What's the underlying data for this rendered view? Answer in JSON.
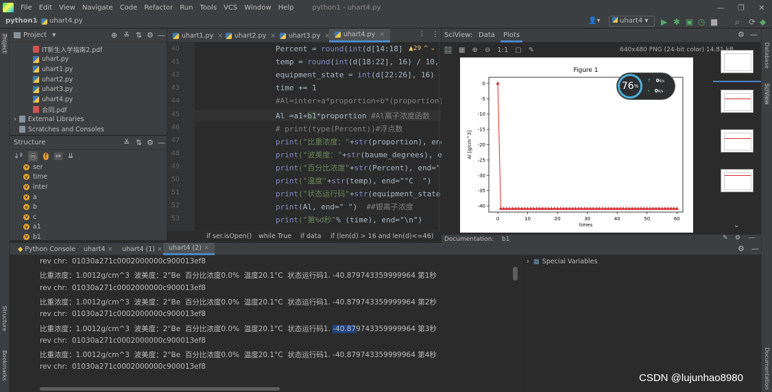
{
  "app": {
    "name": "python1",
    "title": "python1 - uhart4.py",
    "file": "uhart4.py"
  },
  "menu": [
    "File",
    "Edit",
    "View",
    "Navigate",
    "Code",
    "Refactor",
    "Run",
    "Tools",
    "VCS",
    "Window",
    "Help"
  ],
  "run_config": "uhart4",
  "project": {
    "label": "Project",
    "files": [
      "IT新生入学指南2.pdf",
      "uhart.py",
      "uhart1.py",
      "uhart2.py",
      "uhart3.py",
      "uhart4.py",
      "合同.pdf"
    ],
    "external": "External Libraries",
    "scratches": "Scratches and Consoles"
  },
  "structure": {
    "label": "Structure",
    "vars": [
      "ser",
      "time",
      "inter",
      "a",
      "b",
      "c",
      "a1",
      "b1"
    ]
  },
  "editor": {
    "tabs": [
      "uhart1.py",
      "uhart2.py",
      "uhart3.py",
      "uhart4.py"
    ],
    "line_numbers": [
      "40",
      "41",
      "42",
      "43",
      "44",
      "45",
      "46",
      "47",
      "48",
      "49",
      "50",
      "51",
      "52",
      "53"
    ],
    "warnings": "29",
    "lines": [
      [
        "Percent = ",
        "round",
        "(",
        "int",
        "(d[14:18]"
      ],
      [
        "temp = ",
        "round",
        "(",
        "int",
        "(d[18:22], 16) / 10, 1"
      ],
      [
        "equipment_state = ",
        "int",
        "(d[22:26], 16)"
      ],
      [
        "time += 1"
      ],
      [
        "#Al=inter+a*proportion+b*(proportion)"
      ],
      [
        "Al =a1+",
        "b1",
        "*proportion ",
        "#Al离子浓度函数"
      ],
      [
        "# print(type(Percent))#浮点数"
      ],
      [
        "print",
        "(\"比重浓度：\"",
        "+",
        "str",
        "(proportion), end"
      ],
      [
        "print",
        "(\"波美度：\"",
        "+",
        "str",
        "(baume_degrees), e"
      ],
      [
        "print",
        "(\"百分比浓度\"",
        "+",
        "str",
        "(Percent), end=\""
      ],
      [
        "print",
        "(\"温度\"",
        "+",
        "str",
        "(temp), end=\"°C  \")"
      ],
      [
        "print",
        "(\"状态运行码\"",
        "+",
        "str",
        "(equipment_state)"
      ],
      [
        "print",
        "(Al, end=\" \")  ",
        "##银离子浓度"
      ],
      [
        "print",
        "(\"第%d秒\"",
        "% ",
        "(time)",
        ", end=\"\\n\")"
      ]
    ],
    "breadcrumb": [
      "if ser.isOpen()",
      "while True",
      "if data",
      "if (len(d) > 16 and len(d)<=46)"
    ]
  },
  "sciview": {
    "label": "SciView:",
    "tabs": [
      "Data",
      "Plots"
    ],
    "info": "640x480 PNG (24-bit color) 14.81 kB",
    "doc": "Documentation:",
    "doc2": "b1"
  },
  "chart_data": {
    "type": "line",
    "title": "Figure 1",
    "xlabel": "times",
    "ylabel": "Al [g/cm^3]",
    "xlim": [
      -3,
      62
    ],
    "ylim": [
      -42,
      2
    ],
    "xticks": [
      0,
      10,
      20,
      30,
      40,
      50,
      60
    ],
    "yticks": [
      0,
      -5,
      -10,
      -15,
      -20,
      -25,
      -30,
      -35,
      -40
    ],
    "series": [
      {
        "color": "#d62728",
        "x": [
          0,
          1,
          2,
          3,
          4,
          5,
          6,
          7,
          8,
          9,
          10,
          11,
          12,
          13,
          14,
          15,
          16,
          17,
          18,
          19,
          20,
          21,
          22,
          23,
          24,
          25,
          26,
          27,
          28,
          29,
          30,
          31,
          32,
          33,
          34,
          35,
          36,
          37,
          38,
          39,
          40,
          41,
          42,
          43,
          44,
          45,
          46,
          47,
          48,
          49,
          50,
          51,
          52,
          53,
          54,
          55,
          56,
          57,
          58,
          59,
          60
        ],
        "y": [
          0,
          -40.88,
          -40.88,
          -40.88,
          -40.88,
          -40.88,
          -40.88,
          -40.88,
          -40.88,
          -40.88,
          -40.88,
          -40.88,
          -40.88,
          -40.88,
          -40.88,
          -40.88,
          -40.88,
          -40.88,
          -40.88,
          -40.88,
          -40.88,
          -40.88,
          -40.88,
          -40.88,
          -40.88,
          -40.88,
          -40.88,
          -40.88,
          -40.88,
          -40.88,
          -40.88,
          -40.88,
          -40.88,
          -40.88,
          -40.88,
          -40.88,
          -40.88,
          -40.88,
          -40.88,
          -40.88,
          -40.88,
          -40.88,
          -40.88,
          -40.88,
          -40.88,
          -40.88,
          -40.88,
          -40.88,
          -40.88,
          -40.88,
          -40.88,
          -40.88,
          -40.88,
          -40.88,
          -40.88,
          -40.88,
          -40.88,
          -40.88,
          -40.88,
          -40.88,
          -40.88
        ]
      }
    ]
  },
  "netwidget": {
    "percent": "76",
    "unit": "%",
    "up": "0",
    "down": "0",
    "rate_unit": "K/s"
  },
  "bottom": {
    "tabs": [
      "Python Console",
      "uhart4",
      "uhart4 (1)",
      "uhart4 (2)"
    ]
  },
  "console": {
    "lines": [
      "rev chr:  01030a271c0002000000c900013ef8",
      "比重浓度：1.0012g/cm^3  波美度：2°Be  百分比浓度0.0%  温度20.1°C  状态运行码1. -40.879743359999964 第1秒",
      "rev chr:  01030a271c0002000000c900013ef8",
      "比重浓度：1.0012g/cm^3  波美度：2°Be  百分比浓度0.0%  温度20.1°C  状态运行码1. -40.879743359999964 第2秒",
      "rev chr:  01030a271c0002000000c900013ef8",
      "比重浓度：1.0012g/cm^3  波美度：2°Be  百分比浓度0.0%  温度20.1°C  状态运行码1. ",
      "rev chr:  01030a271c0002000000c900013ef8",
      "比重浓度：1.0012g/cm^3  波美度：2°Be  百分比浓度0.0%  温度20.1°C  状态运行码1. -40.879743359999964 第4秒",
      "rev chr:  01030a271c0002000000c900013ef8"
    ],
    "sel": "-40.87",
    "sel_rest": "9743359999964 第3秒"
  },
  "variables": {
    "label": "Special Variables"
  },
  "right_stripe": [
    "Database",
    "SciView",
    "Documentation"
  ],
  "left_stripe": [
    "Project",
    "Structure",
    "Bookmarks"
  ],
  "watermark": "CSDN @lujunhao8980"
}
